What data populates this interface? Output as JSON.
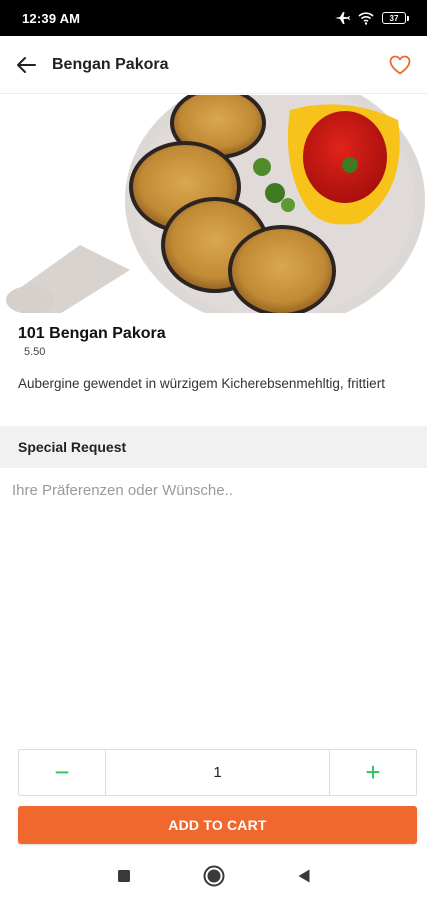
{
  "status_bar": {
    "time": "12:39 AM",
    "battery": "37"
  },
  "app_bar": {
    "title": "Bengan Pakora",
    "back_icon": "arrow-left-icon",
    "favorite_icon": "heart-outline-icon"
  },
  "colors": {
    "accent": "#f0682d",
    "stepper": "#2ec05a",
    "section_bg": "#f1f1f1"
  },
  "product": {
    "name": "101 Bengan Pakora",
    "price": "5.50",
    "description": "Aubergine gewendet in würzigem Kicherebsenmehltig, frittiert"
  },
  "special_request": {
    "header": "Special Request",
    "placeholder": "Ihre Präferenzen oder Wünsche..",
    "value": ""
  },
  "quantity": {
    "minus": "−",
    "value": "1",
    "plus": "+"
  },
  "cart": {
    "button_label": "ADD TO CART"
  },
  "nav": {
    "recents_icon": "square-icon",
    "home_icon": "circle-icon",
    "back_icon": "triangle-back-icon"
  }
}
